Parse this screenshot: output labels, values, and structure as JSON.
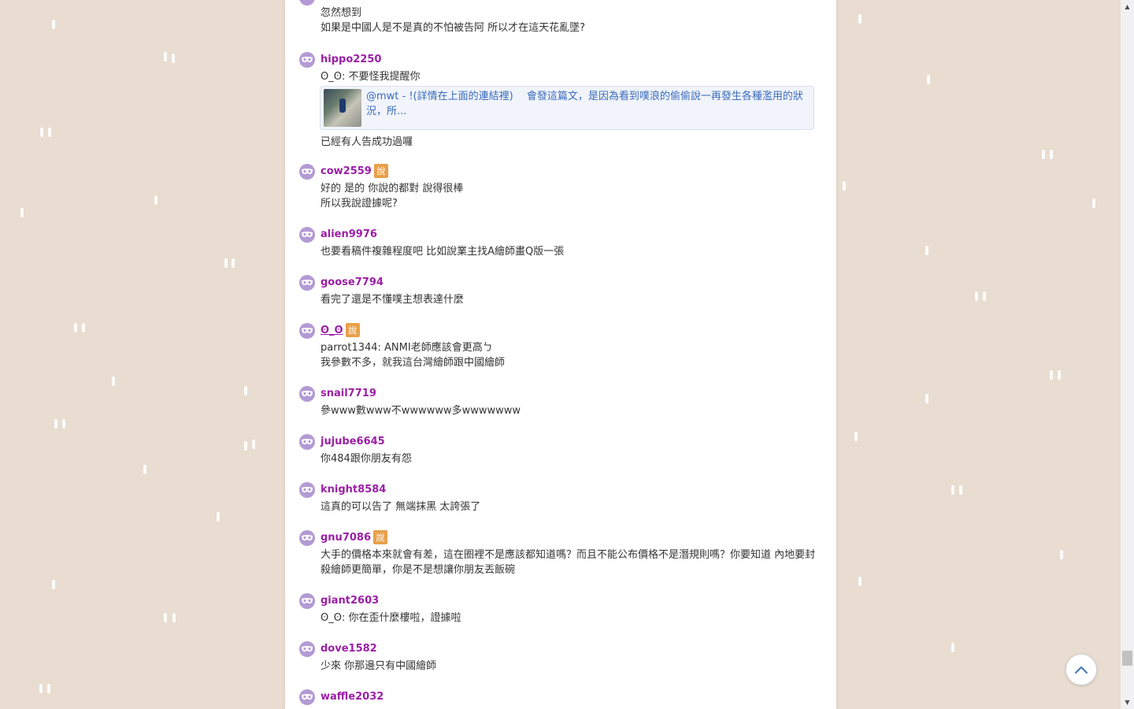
{
  "theme": {
    "accent_name_color": "#9b1fa6",
    "avatar_color": "#b39ad4",
    "badge_color": "#e8a04a",
    "background": "#e8ddd0"
  },
  "responses": [
    {
      "lines": [
        "忽然想到",
        "如果是中國人是不是真的不怕被告阿 所以才在這天花亂墜?"
      ]
    },
    {
      "user": "hippo2250",
      "lines": [
        "ʘ_ʘ: 不要怪我提醒你"
      ],
      "link_preview": "@mwt - !(詳情在上面的連結裡)　  會發這篇文，是因為看到噗浪的偷偷說一再發生各種濫用的狀況，所...",
      "after_lines": [
        "已經有人告成功過囉"
      ]
    },
    {
      "user": "cow2559",
      "badge": "說",
      "lines": [
        "好的 是的 你說的都對 說得很棒",
        "所以我說證據呢?"
      ]
    },
    {
      "user": "alien9976",
      "lines": [
        "也要看稿件複雜程度吧 比如說業主找A繪師畫Q版一張"
      ]
    },
    {
      "user": "goose7794",
      "lines": [
        "看完了還是不懂噗主想表達什麼"
      ]
    },
    {
      "user": "ʘ_ʘ",
      "badge": "說",
      "lines": [
        "parrot1344: ANMI老師應該會更高ㄅ",
        "我參數不多，就我這台灣繪師跟中國繪師"
      ]
    },
    {
      "user": "snail7719",
      "lines": [
        "參www數www不wwwwww多wwwwwww"
      ]
    },
    {
      "user": "jujube6645",
      "lines": [
        "你484跟你朋友有怨"
      ]
    },
    {
      "user": "knight8584",
      "lines": [
        "這真的可以告了 無端抹黑 太誇張了"
      ]
    },
    {
      "user": "gnu7086",
      "badge": "說",
      "lines": [
        "大手的價格本來就會有差，這在圈裡不是應該都知道嗎？而且不能公布價格不是潛規則嗎？你要知道 內地要封殺繪師更簡單，你是不是想讓你朋友丟飯碗"
      ]
    },
    {
      "user": "giant2603",
      "lines": [
        "ʘ_ʘ: 你在歪什麼樓啦，證據啦"
      ]
    },
    {
      "user": "dove1582",
      "lines": [
        "少來 你那邊只有中國繪師"
      ]
    },
    {
      "user": "waffle2032",
      "lines": []
    }
  ],
  "scroll_top_icon": "chevron-up-icon",
  "avatar_icon": "mask-icon"
}
